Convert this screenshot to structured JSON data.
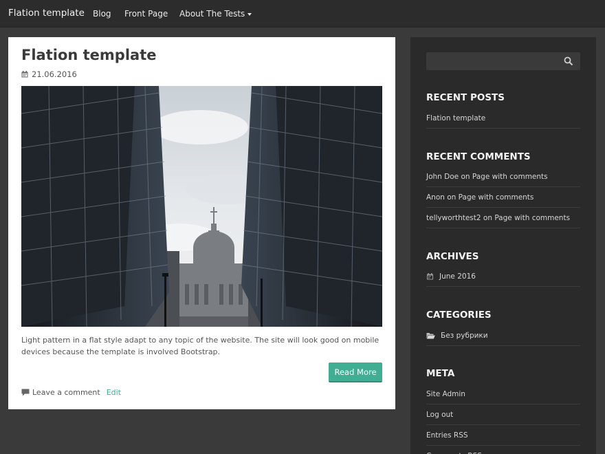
{
  "navbar": {
    "brand": "Flation template",
    "items": [
      "Blog",
      "Front Page",
      "About The Tests"
    ]
  },
  "post": {
    "title": "Flation template",
    "date": "21.06.2016",
    "excerpt": "Light pattern in a flat style adapt to any topic of the website. The site will look good on mobile devices because the template is involved Bootstrap.",
    "read_more": "Read More",
    "leave_comment": "Leave a comment",
    "edit": "Edit"
  },
  "sidebar": {
    "search": {
      "placeholder": ""
    },
    "recent_posts": {
      "title": "RECENT POSTS",
      "items": [
        "Flation template"
      ]
    },
    "recent_comments": {
      "title": "RECENT COMMENTS",
      "items": [
        "John Doe on Page with comments",
        "Anon on Page with comments",
        "tellyworthtest2 on Page with comments"
      ]
    },
    "archives": {
      "title": "ARCHIVES",
      "items": [
        "June 2016"
      ]
    },
    "categories": {
      "title": "CATEGORIES",
      "items": [
        "Без рубрики"
      ]
    },
    "meta": {
      "title": "META",
      "items": [
        "Site Admin",
        "Log out",
        "Entries RSS",
        "Comments RSS"
      ]
    }
  },
  "colors": {
    "accent": "#3fae93",
    "background": "#3a3a3a",
    "sidebar": "#2a2a2a",
    "navbar": "#2c2c2c"
  },
  "icons": [
    "calendar-icon",
    "comment-icon",
    "search-icon",
    "folder-open-icon"
  ]
}
